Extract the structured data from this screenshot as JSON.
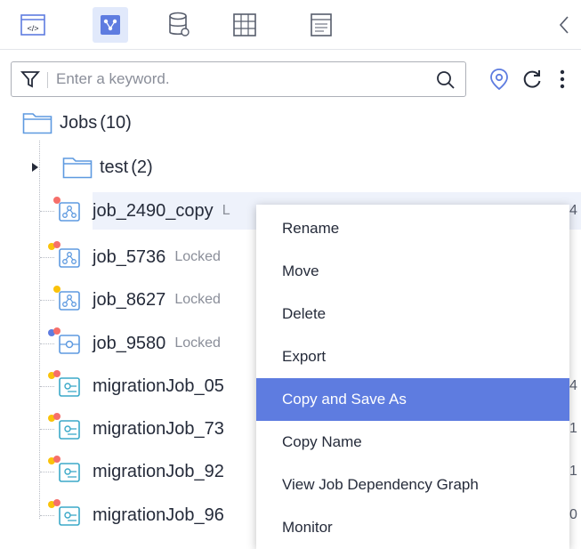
{
  "toolbar": {
    "icons": [
      "code-icon",
      "job-network-icon",
      "database-icon",
      "grid-table-icon",
      "script-doc-icon"
    ],
    "active_index": 1
  },
  "search": {
    "placeholder": "Enter a keyword."
  },
  "tree": {
    "root": {
      "label": "Jobs",
      "count": "(10)"
    },
    "folder": {
      "label": "test",
      "count": "(2)"
    },
    "jobs": [
      {
        "name": "job_2490_copy",
        "tag": "L",
        "icon": "job-flow-icon",
        "right": "4"
      },
      {
        "name": "job_5736",
        "tag": "Locked",
        "icon": "job-flow-icon",
        "right": ""
      },
      {
        "name": "job_8627",
        "tag": "Locked",
        "icon": "job-flow-icon",
        "right": ""
      },
      {
        "name": "job_9580",
        "tag": "Locked",
        "icon": "job-single-icon",
        "right": ""
      },
      {
        "name": "migrationJob_05",
        "tag": "",
        "icon": "migration-icon",
        "right": "4"
      },
      {
        "name": "migrationJob_73",
        "tag": "",
        "icon": "migration-icon",
        "right": "1"
      },
      {
        "name": "migrationJob_92",
        "tag": "",
        "icon": "migration-icon",
        "right": "1"
      },
      {
        "name": "migrationJob_96",
        "tag": "",
        "icon": "migration-icon",
        "right": "0"
      }
    ]
  },
  "context_menu": {
    "items": [
      "Rename",
      "Move",
      "Delete",
      "Export",
      "Copy and Save As",
      "Copy Name",
      "View Job Dependency Graph",
      "Monitor"
    ],
    "highlighted": "Copy and Save As"
  },
  "colors": {
    "accent": "#5e7ce0",
    "selected_row": "#eef2fb",
    "red_dot": "#f66f6a",
    "yellow_dot": "#fac20a",
    "icon_blue": "#5e7ce0",
    "icon_teal": "#3ba9c8"
  }
}
